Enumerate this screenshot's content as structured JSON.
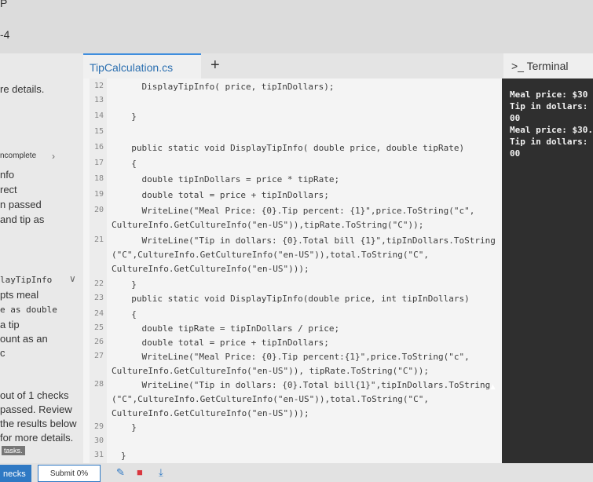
{
  "top": {
    "p": "P",
    "num": "-4"
  },
  "tabs": {
    "file": "TipCalculation.cs",
    "plus": "+",
    "terminal": ">_ Terminal"
  },
  "left_panel": {
    "details": "re details.",
    "incomplete": "ncomplete",
    "i1": "nfo",
    "i2": "rect",
    "i3": "n passed",
    "i4": "and tip as",
    "s1": "layTipInfo",
    "s2": "pts meal",
    "s3": "e as double",
    "s4": "a tip",
    "s5": "ount as an",
    "s6": "c",
    "r1": "out of 1 checks",
    "r2": "passed. Review",
    "r3": "the results below",
    "r4": "for more details.",
    "tasks": "tasks."
  },
  "code_lines": [
    {
      "n": "12",
      "t": "    DisplayTipInfo( price, tipInDollars);"
    },
    {
      "n": "13",
      "t": ""
    },
    {
      "n": "14",
      "t": "  }"
    },
    {
      "n": "15",
      "t": ""
    },
    {
      "n": "16",
      "t": "  public static void DisplayTipInfo( double price, double tipRate)"
    },
    {
      "n": "17",
      "t": "  {"
    },
    {
      "n": "18",
      "t": "    double tipInDollars = price * tipRate;"
    },
    {
      "n": "19",
      "t": "    double total = price + tipInDollars;"
    },
    {
      "n": "20",
      "t": "    WriteLine(\"Meal Price: {0}.Tip percent: {1}\",price.ToString(\"c\","
    },
    {
      "n": "",
      "t": "CultureInfo.GetCultureInfo(\"en-US\")),tipRate.ToString(\"C\"));"
    },
    {
      "n": "21",
      "t": "    WriteLine(\"Tip in dollars: {0}.Total bill {1}\",tipInDollars.ToString"
    },
    {
      "n": "",
      "t": "(\"C\",CultureInfo.GetCultureInfo(\"en-US\")),total.ToString(\"C\","
    },
    {
      "n": "",
      "t": "CultureInfo.GetCultureInfo(\"en-US\")));"
    },
    {
      "n": "22",
      "t": "  }"
    },
    {
      "n": "23",
      "t": "  public static void DisplayTipInfo(double price, int tipInDollars)"
    },
    {
      "n": "24",
      "t": "  {"
    },
    {
      "n": "25",
      "t": "    double tipRate = tipInDollars / price;"
    },
    {
      "n": "26",
      "t": "    double total = price + tipInDollars;"
    },
    {
      "n": "27",
      "t": "    WriteLine(\"Meal Price: {0}.Tip percent:{1}\",price.ToString(\"c\","
    },
    {
      "n": "",
      "t": "CultureInfo.GetCultureInfo(\"en-US\")), tipRate.ToString(\"C\"));"
    },
    {
      "n": "28",
      "t": "    WriteLine(\"Tip in dollars: {0}.Total bill{1}\",tipInDollars.ToString"
    },
    {
      "n": "",
      "t": "(\"C\",CultureInfo.GetCultureInfo(\"en-US\")),total.ToString(\"C\","
    },
    {
      "n": "",
      "t": "CultureInfo.GetCultureInfo(\"en-US\")));"
    },
    {
      "n": "29",
      "t": "  }"
    },
    {
      "n": "30",
      "t": ""
    },
    {
      "n": "31",
      "t": "}"
    },
    {
      "n": "32",
      "t": ""
    }
  ],
  "terminal_lines": [
    "Meal price: $30",
    "Tip in dollars:",
    "00",
    "Meal price: $30.",
    "Tip in dollars:",
    "00"
  ],
  "bottom": {
    "checks": "necks",
    "submit": "Submit 0%"
  },
  "colors": {
    "accent": "#2f79c4",
    "terminal_bg": "#2f2f2f",
    "trash": "#d9363e"
  }
}
